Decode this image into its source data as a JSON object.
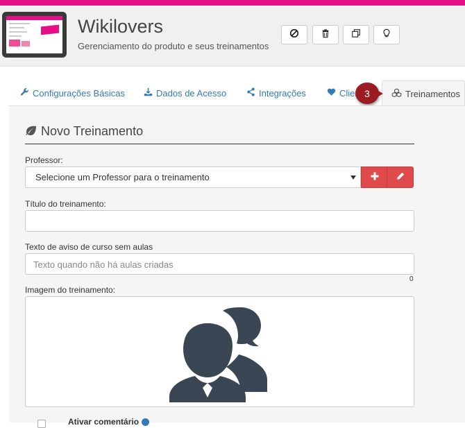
{
  "header": {
    "title": "Wikilovers",
    "subtitle": "Gerenciamento do produto e seus treinamentos",
    "buttons": [
      {
        "icon": "ban-icon"
      },
      {
        "icon": "trash-icon"
      },
      {
        "icon": "duplicate-icon"
      },
      {
        "icon": "lightbulb-icon"
      }
    ]
  },
  "tabs": [
    {
      "label": "Configurações Básicas",
      "icon": "wrench-icon"
    },
    {
      "label": "Dados de Acesso",
      "icon": "download-icon"
    },
    {
      "label": "Integrações",
      "icon": "share-icon"
    },
    {
      "label": "Clien",
      "icon": "heart-icon"
    },
    {
      "label": "Treinamentos",
      "icon": "cubes-icon",
      "active": true
    }
  ],
  "step_badge": "3",
  "form": {
    "section_title": "Novo Treinamento",
    "professor_label": "Professor:",
    "professor_selected": "Selecione um Professor para o treinamento",
    "title_label": "Título do treinamento:",
    "title_value": "",
    "notice_label": "Texto de aviso de curso sem aulas",
    "notice_placeholder": "Texto quando não há aulas criadas",
    "notice_count": "0",
    "image_label": "Imagem do treinamento:",
    "comment_label": "Ativar comentário"
  },
  "colors": {
    "brand": "#e60f88",
    "danger": "#df4a4a",
    "link": "#337ab7",
    "badge": "#9b1b22"
  }
}
